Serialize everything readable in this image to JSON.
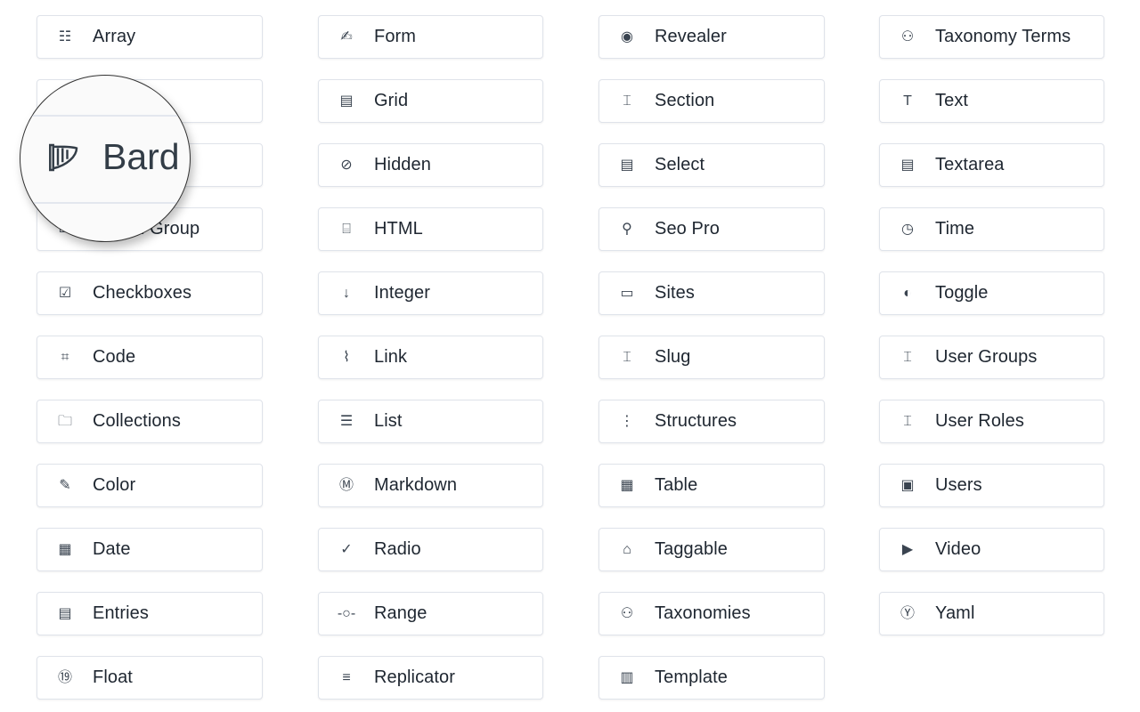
{
  "columns": [
    [
      {
        "label": "Array",
        "icon": "array-icon"
      },
      {
        "label": "",
        "icon": "assets-icon"
      },
      {
        "label": "Bard",
        "icon": "harp-icon"
      },
      {
        "label": "Button Group",
        "icon": "button-group-icon"
      },
      {
        "label": "Checkboxes",
        "icon": "checkbox-icon"
      },
      {
        "label": "Code",
        "icon": "code-icon"
      },
      {
        "label": "Collections",
        "icon": "collections-icon"
      },
      {
        "label": "Color",
        "icon": "color-palette-icon"
      },
      {
        "label": "Date",
        "icon": "calendar-icon"
      },
      {
        "label": "Entries",
        "icon": "entries-icon"
      },
      {
        "label": "Float",
        "icon": "float-icon"
      }
    ],
    [
      {
        "label": "Form",
        "icon": "form-icon"
      },
      {
        "label": "Grid",
        "icon": "grid-icon"
      },
      {
        "label": "Hidden",
        "icon": "eye-slash-icon"
      },
      {
        "label": "HTML",
        "icon": "html-icon"
      },
      {
        "label": "Integer",
        "icon": "integer-sort-icon"
      },
      {
        "label": "Link",
        "icon": "paperclip-icon"
      },
      {
        "label": "List",
        "icon": "list-icon"
      },
      {
        "label": "Markdown",
        "icon": "markdown-icon"
      },
      {
        "label": "Radio",
        "icon": "radio-check-icon"
      },
      {
        "label": "Range",
        "icon": "range-icon"
      },
      {
        "label": "Replicator",
        "icon": "replicator-icon"
      }
    ],
    [
      {
        "label": "Revealer",
        "icon": "revealer-eye-icon"
      },
      {
        "label": "Section",
        "icon": "section-icon"
      },
      {
        "label": "Select",
        "icon": "select-icon"
      },
      {
        "label": "Seo Pro",
        "icon": "seo-search-icon"
      },
      {
        "label": "Sites",
        "icon": "sites-icon"
      },
      {
        "label": "Slug",
        "icon": "slug-icon"
      },
      {
        "label": "Structures",
        "icon": "structures-icon"
      },
      {
        "label": "Table",
        "icon": "table-icon"
      },
      {
        "label": "Taggable",
        "icon": "tag-icon"
      },
      {
        "label": "Taxonomies",
        "icon": "taxonomy-icon"
      },
      {
        "label": "Template",
        "icon": "template-icon"
      }
    ],
    [
      {
        "label": "Taxonomy Terms",
        "icon": "taxonomy-icon"
      },
      {
        "label": "Text",
        "icon": "text-cursor-icon"
      },
      {
        "label": "Textarea",
        "icon": "textarea-icon"
      },
      {
        "label": "Time",
        "icon": "clock-icon"
      },
      {
        "label": "Toggle",
        "icon": "toggle-icon"
      },
      {
        "label": "User Groups",
        "icon": "user-groups-icon"
      },
      {
        "label": "User Roles",
        "icon": "user-roles-icon"
      },
      {
        "label": "Users",
        "icon": "users-card-icon"
      },
      {
        "label": "Video",
        "icon": "video-icon"
      },
      {
        "label": "Yaml",
        "icon": "yaml-icon"
      }
    ]
  ],
  "magnifier": {
    "label": "Bard",
    "icon": "harp-icon"
  }
}
